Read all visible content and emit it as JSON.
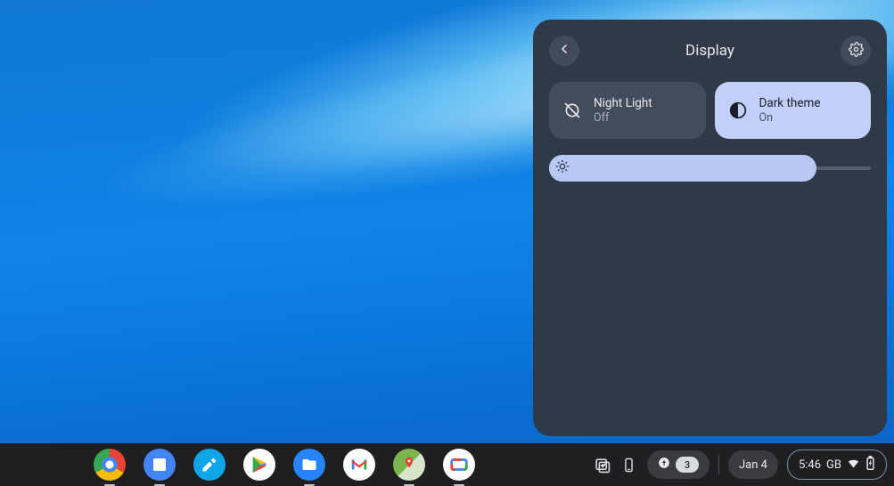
{
  "panel": {
    "title": "Display",
    "tiles": [
      {
        "label": "Night Light",
        "state": "Off"
      },
      {
        "label": "Dark theme",
        "state": "On"
      }
    ],
    "brightness_percent": 83
  },
  "shelf": {
    "apps": [
      {
        "name": "chrome",
        "running": true
      },
      {
        "name": "docs",
        "running": true
      },
      {
        "name": "paint",
        "running": false
      },
      {
        "name": "play",
        "running": false
      },
      {
        "name": "files",
        "running": true
      },
      {
        "name": "gmail",
        "running": false
      },
      {
        "name": "maps",
        "running": true
      },
      {
        "name": "video",
        "running": true
      }
    ],
    "notification_count": "3",
    "date": "Jan 4",
    "time": "5:46",
    "locale": "GB"
  }
}
